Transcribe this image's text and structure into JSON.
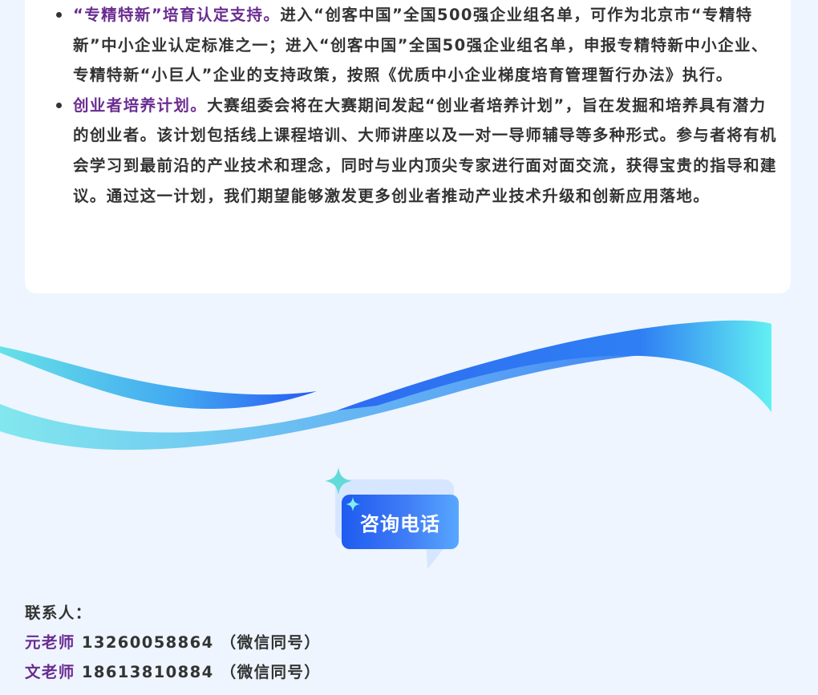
{
  "list": {
    "items": [
      {
        "highlight": "“专精特新”培育认定支持。",
        "text": "进入“创客中国”全国500强企业组名单，可作为北京市“专精特新”中小企业认定标准之一；进入“创客中国”全国50强企业组名单，申报专精特新中小企业、专精特新“小巨人”企业的支持政策，按照《优质中小企业梯度培育管理暂行办法》执行。"
      },
      {
        "highlight": "创业者培养计划。",
        "text": "大赛组委会将在大赛期间发起“创业者培养计划”，旨在发掘和培养具有潜力的创业者。该计划包括线上课程培训、大师讲座以及一对一导师辅导等多种形式。参与者将有机会学习到最前沿的产业技术和理念，同时与业内顶尖专家进行面对面交流，获得宝贵的指导和建议。通过这一计划，我们期望能够激发更多创业者推动产业技术升级和创新应用落地。"
      }
    ]
  },
  "badge": {
    "label": "咨询电话"
  },
  "contact": {
    "title": "联系人：",
    "people": [
      {
        "name": "元老师",
        "phone": "13260058864",
        "note": "（微信同号）"
      },
      {
        "name": "文老师",
        "phone": "18613810884",
        "note": "（微信同号）"
      }
    ]
  },
  "colors": {
    "highlight": "#6a2c91",
    "text": "#333333",
    "background": "#eef5ff",
    "badge_blue": "#1e5bf0",
    "wave_cyan": "#5fe0e6"
  },
  "icons": [
    "sparkle-icon",
    "bullet-dot-icon"
  ]
}
